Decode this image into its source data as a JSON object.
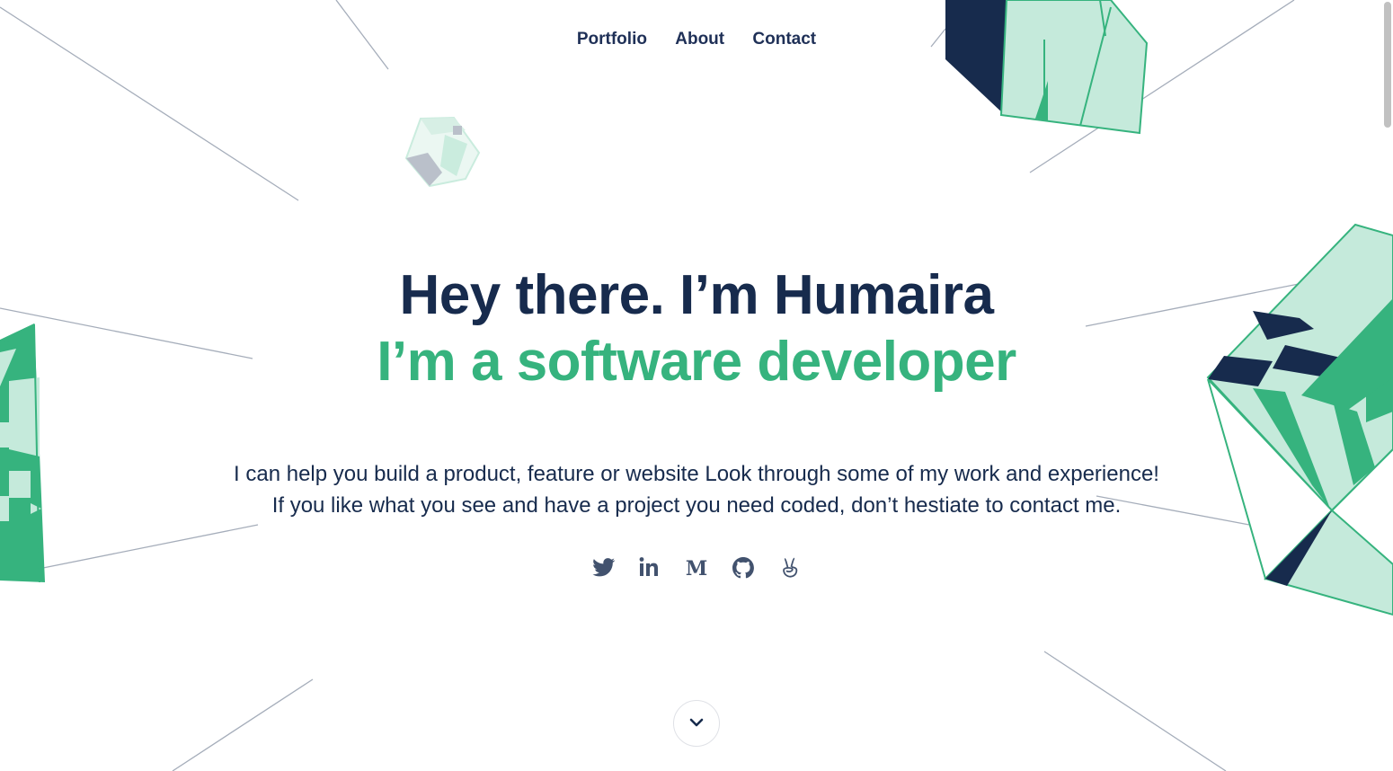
{
  "nav": {
    "items": [
      {
        "label": "Portfolio"
      },
      {
        "label": "About"
      },
      {
        "label": "Contact"
      }
    ]
  },
  "hero": {
    "headline": "Hey there. I’m Humaira",
    "subheadline": "I’m a software developer",
    "description_line1": "I can help you build a product, feature or website Look through some of my work and experience!",
    "description_line2": "If you like what you see and have a project you need coded, don’t hestiate to contact me."
  },
  "socials": [
    {
      "icon": "twitter-icon"
    },
    {
      "icon": "linkedin-icon"
    },
    {
      "icon": "medium-icon"
    },
    {
      "icon": "github-icon"
    },
    {
      "icon": "angellist-icon"
    }
  ],
  "scroll_button": {
    "icon": "chevron-down-icon"
  },
  "colors": {
    "navy": "#172b4d",
    "green": "#36b37e",
    "mint": "#c5eadb",
    "icon_gray": "#42526e",
    "line_gray": "#a5adba"
  }
}
